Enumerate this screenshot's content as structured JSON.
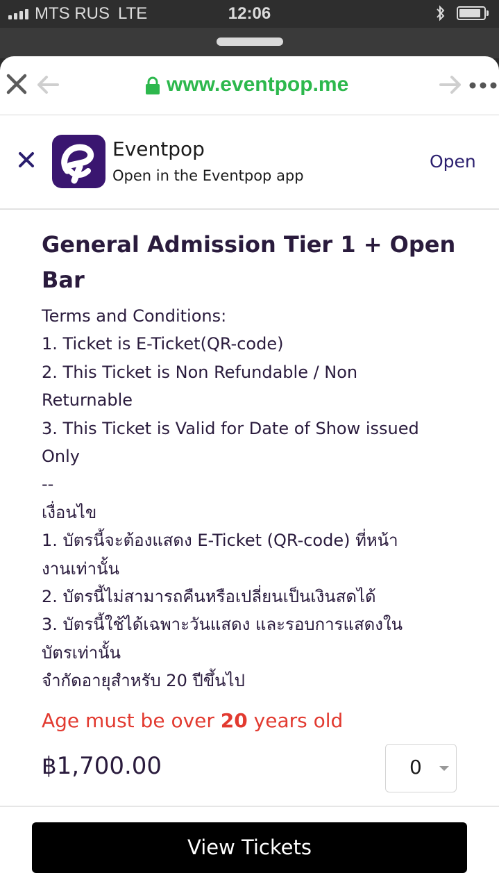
{
  "status_bar": {
    "carrier": "MTS RUS",
    "network": "LTE",
    "time": "12:06",
    "bluetooth_icon": "bluetooth-icon",
    "battery_icon": "battery-icon"
  },
  "browser": {
    "url": "www.eventpop.me",
    "url_color": "#2db84d",
    "icons": [
      "close-icon",
      "back-arrow-icon",
      "lock-icon",
      "forward-arrow-icon",
      "more-icon"
    ]
  },
  "app_banner": {
    "app_name": "Eventpop",
    "subtitle": "Open in the Eventpop app",
    "open_label": "Open",
    "logo_color": "#3a1670",
    "icons": [
      "close-icon",
      "eventpop-logo-icon"
    ]
  },
  "ticket": {
    "title_lines": [
      "General Admission Tier 1 + Open",
      "Bar"
    ],
    "terms_lines": [
      "Terms and Conditions:",
      "1. Ticket is E-Ticket(QR-code)",
      "2. This Ticket is Non Refundable / Non",
      "Returnable",
      "3. This Ticket is Valid for Date of Show issued",
      "Only",
      "--",
      "เงื่อนไข",
      "1. บัตรนี้จะต้องแสดง E-Ticket (QR-code) ที่หน้า",
      "งานเท่านั้น",
      "2. บัตรนี้ไม่สามารถคืนหรือเปลี่ยนเป็นเงินสดได้",
      "3. บัตรนี้ใช้ได้เฉพาะวันแสดง และรอบการแสดงใน",
      "บัตรเท่านั้น",
      "จำกัดอายุสำหรับ 20 ปีขึ้นไป"
    ],
    "age_warning_prefix": "Age must be over ",
    "age_warning_number": "20",
    "age_warning_suffix": " years old",
    "age_warning_color": "#e23a30",
    "price": "฿1,700.00",
    "quantity": "0"
  },
  "footer": {
    "button_label": "View Tickets"
  }
}
